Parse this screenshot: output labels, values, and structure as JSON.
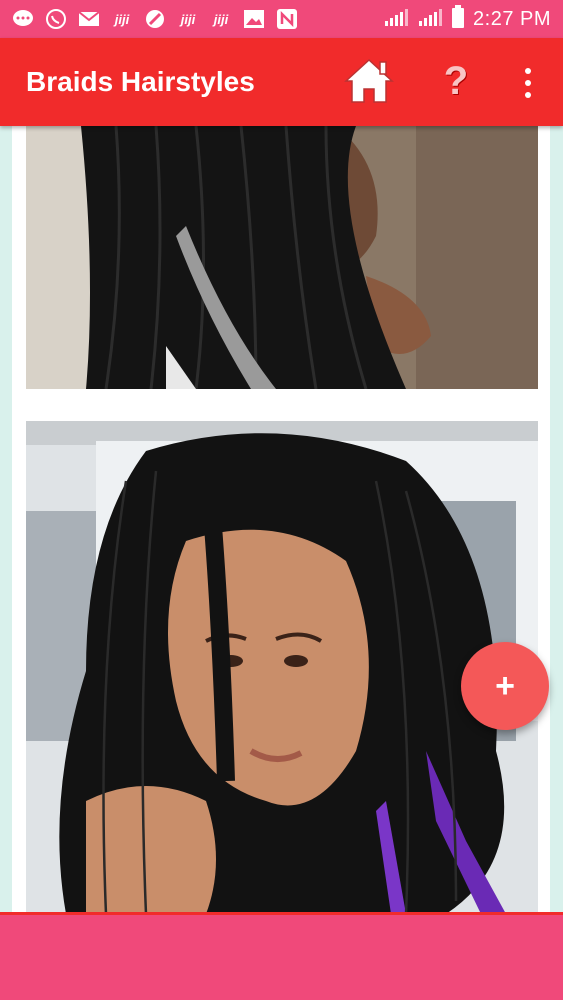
{
  "status_bar": {
    "icons": [
      "message-icon",
      "whatsapp-icon",
      "mail-icon",
      "jiji-icon",
      "browser-icon",
      "jiji-icon",
      "jiji-icon",
      "gallery-icon",
      "n-icon"
    ],
    "signal_icons": [
      "signal-icon",
      "signal-icon",
      "battery-icon"
    ],
    "time": "2:27 PM"
  },
  "app_bar": {
    "title": "Braids Hairstyles",
    "home_icon": "home-icon",
    "help_icon": "help-icon",
    "help_symbol": "?",
    "more_icon": "more-vert-icon",
    "color": "#f12b2b"
  },
  "content": {
    "images": [
      {
        "subject": "box-braids-photo-1"
      },
      {
        "subject": "box-braids-photo-2"
      }
    ]
  },
  "fab": {
    "symbol": "+",
    "icon": "add-icon",
    "color": "#f45858"
  },
  "bottom_banner": {
    "color": "#f0497a"
  }
}
